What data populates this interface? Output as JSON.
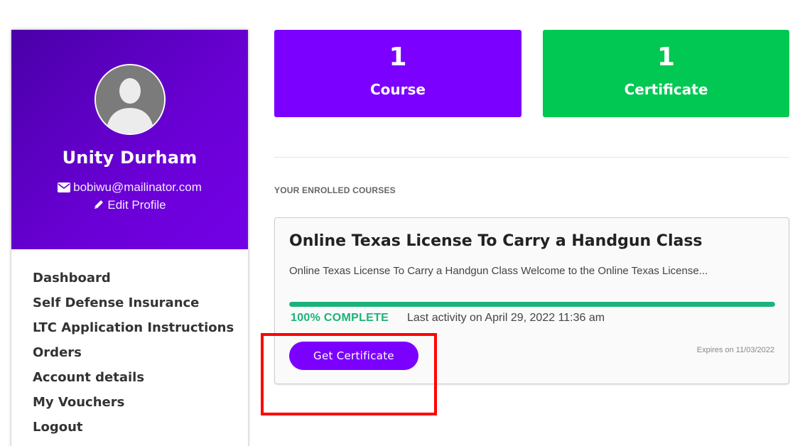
{
  "profile": {
    "name": "Unity Durham",
    "email": "bobiwu@mailinator.com",
    "edit_label": "Edit Profile",
    "avatar_icon": "user-silhouette-icon"
  },
  "menu": {
    "items": [
      {
        "label": "Dashboard"
      },
      {
        "label": "Self Defense Insurance"
      },
      {
        "label": "LTC Application Instructions"
      },
      {
        "label": "Orders"
      },
      {
        "label": "Account details"
      },
      {
        "label": "My Vouchers"
      },
      {
        "label": "Logout"
      }
    ]
  },
  "stats": {
    "courses": {
      "count": "1",
      "label": "Course",
      "color": "#7b00ff"
    },
    "certificates": {
      "count": "1",
      "label": "Certificate",
      "color": "#00c853"
    }
  },
  "enrolled": {
    "section_title": "YOUR ENROLLED COURSES",
    "course": {
      "title": "Online Texas License To Carry a Handgun Class",
      "description": "Online Texas License To Carry a Handgun Class Welcome to the Online Texas License...",
      "progress_percent": 100,
      "progress_label": "100% COMPLETE",
      "last_activity": "Last activity on April 29, 2022 11:36 am",
      "button_label": "Get Certificate",
      "expires": "Expires on 11/03/2022",
      "accent_color": "#7b00ff",
      "progress_color": "#1bb37a"
    }
  },
  "icons": {
    "email": "envelope-icon",
    "edit": "pencil-icon"
  },
  "annotation": {
    "highlight_color": "#ff0000"
  }
}
